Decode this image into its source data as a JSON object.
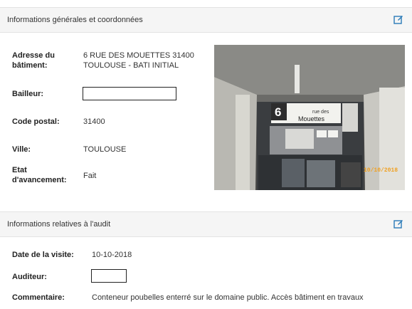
{
  "general": {
    "title": "Informations générales et coordonnées",
    "edit_icon": "edit-icon",
    "adresse_label": "Adresse du bâtiment:",
    "adresse_value_line1": "6 RUE DES MOUETTES 31400",
    "adresse_value_line2": "TOULOUSE - BATI INITIAL",
    "bailleur_label": "Bailleur:",
    "bailleur_value": "",
    "cp_label": "Code postal:",
    "cp_value": "31400",
    "ville_label": "Ville:",
    "ville_value": "TOULOUSE",
    "etat_label": "Etat d'avancement:",
    "etat_value": "Fait",
    "photo": {
      "number": "6",
      "street_line1": "rue des",
      "street_line2": "Mouettes",
      "date_stamp": "10/10/2018"
    }
  },
  "audit": {
    "title": "Informations relatives à l'audit",
    "edit_icon": "edit-icon",
    "date_label": "Date de la visite:",
    "date_value": "10-10-2018",
    "auditeur_label": "Auditeur:",
    "auditeur_value": "",
    "commentaire_label": "Commentaire:",
    "commentaire_value": "Conteneur poubelles enterré sur le domaine public. Accès bâtiment en travaux"
  },
  "colors": {
    "accent": "#2a7ab8",
    "panel_bg": "#f5f5f5"
  }
}
